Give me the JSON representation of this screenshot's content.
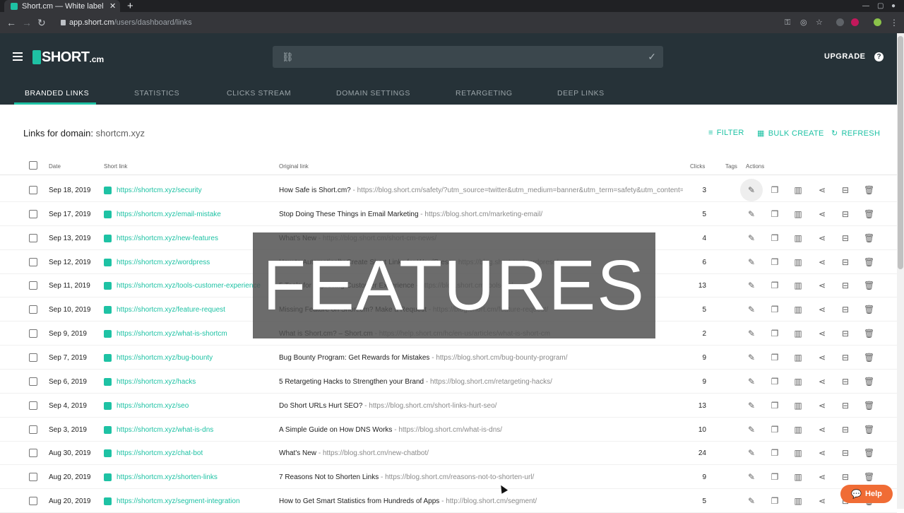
{
  "browser": {
    "tab_title": "Short.cm — White label U",
    "url_host": "app.short.cm",
    "url_path": "/users/dashboard/links"
  },
  "header": {
    "logo_text": "SHORT",
    "logo_tld": ".cm",
    "search_placeholder": "",
    "upgrade_label": "UPGRADE",
    "help_label": "?"
  },
  "nav_tabs": [
    {
      "label": "BRANDED LINKS",
      "active": true
    },
    {
      "label": "STATISTICS"
    },
    {
      "label": "CLICKS STREAM"
    },
    {
      "label": "DOMAIN SETTINGS"
    },
    {
      "label": "RETARGETING"
    },
    {
      "label": "DEEP LINKS"
    }
  ],
  "content": {
    "links_for_label": "Links for domain:",
    "domain": "shortcm.xyz",
    "filter_label": "FILTER",
    "bulk_create_label": "BULK CREATE",
    "refresh_label": "REFRESH"
  },
  "table": {
    "columns": {
      "date": "Date",
      "short_link": "Short link",
      "original_link": "Original link",
      "clicks": "Clicks",
      "tags": "Tags",
      "actions": "Actions"
    },
    "rows": [
      {
        "date": "Sep 18, 2019",
        "short": "https://shortcm.xyz/security",
        "title": "How Safe is Short.cm?",
        "url": "https://blog.short.cm/safety/?utm_source=twitter&utm_medium=banner&utm_term=safety&utm_content=a...",
        "clicks": "3"
      },
      {
        "date": "Sep 17, 2019",
        "short": "https://shortcm.xyz/email-mistake",
        "title": "Stop Doing These Things in Email Marketing",
        "url": "https://blog.short.cm/marketing-email/",
        "clicks": "5"
      },
      {
        "date": "Sep 13, 2019",
        "short": "https://shortcm.xyz/new-features",
        "title": "What's New",
        "url": "https://blog.short.cm/short-cm-news/",
        "clicks": "4"
      },
      {
        "date": "Sep 12, 2019",
        "short": "https://shortcm.xyz/wordpress",
        "title": "How to Automatically Create Short Links for WordPress",
        "url": "https://blog.short.cm/wordpress/",
        "clicks": "6"
      },
      {
        "date": "Sep 11, 2019",
        "short": "https://shortcm.xyz/tools-customer-experience",
        "title": "5 Tools for Improving Customer Experience",
        "url": "https://blog.short.cm/tools-ux/",
        "clicks": "13"
      },
      {
        "date": "Sep 10, 2019",
        "short": "https://shortcm.xyz/feature-request",
        "title": "Missing Feature on Short.cm? Make a Request",
        "url": "https://blog.short.cm/feature-request/",
        "clicks": "5"
      },
      {
        "date": "Sep 9, 2019",
        "short": "https://shortcm.xyz/what-is-shortcm",
        "title": "What is Short.cm? – Short.cm",
        "url": "https://help.short.cm/hc/en-us/articles/what-is-short-cm",
        "clicks": "2"
      },
      {
        "date": "Sep 7, 2019",
        "short": "https://shortcm.xyz/bug-bounty",
        "title": "Bug Bounty Program: Get Rewards for Mistakes",
        "url": "https://blog.short.cm/bug-bounty-program/",
        "clicks": "9"
      },
      {
        "date": "Sep 6, 2019",
        "short": "https://shortcm.xyz/hacks",
        "title": "5 Retargeting Hacks to Strengthen your Brand",
        "url": "https://blog.short.cm/retargeting-hacks/",
        "clicks": "9"
      },
      {
        "date": "Sep 4, 2019",
        "short": "https://shortcm.xyz/seo",
        "title": "Do Short URLs Hurt SEO?",
        "url": "https://blog.short.cm/short-links-hurt-seo/",
        "clicks": "13"
      },
      {
        "date": "Sep 3, 2019",
        "short": "https://shortcm.xyz/what-is-dns",
        "title": "A Simple Guide on How DNS Works",
        "url": "https://blog.short.cm/what-is-dns/",
        "clicks": "10"
      },
      {
        "date": "Aug 30, 2019",
        "short": "https://shortcm.xyz/chat-bot",
        "title": "What's New",
        "url": "https://blog.short.cm/new-chatbot/",
        "clicks": "24"
      },
      {
        "date": "Aug 20, 2019",
        "short": "https://shortcm.xyz/shorten-links",
        "title": "7 Reasons Not to Shorten Links",
        "url": "https://blog.short.cm/reasons-not-to-shorten-url/",
        "clicks": "9"
      },
      {
        "date": "Aug 20, 2019",
        "short": "https://shortcm.xyz/segment-integration",
        "title": "How to Get Smart Statistics from Hundreds of Apps",
        "url": "http://blog.short.cm/segment/",
        "clicks": "5"
      }
    ]
  },
  "overlay": {
    "text": "FEATURES"
  },
  "help_widget": {
    "label": "Help"
  },
  "colors": {
    "accent": "#1ec2a4",
    "header_bg": "#263238",
    "help_bg": "#f06c35"
  }
}
